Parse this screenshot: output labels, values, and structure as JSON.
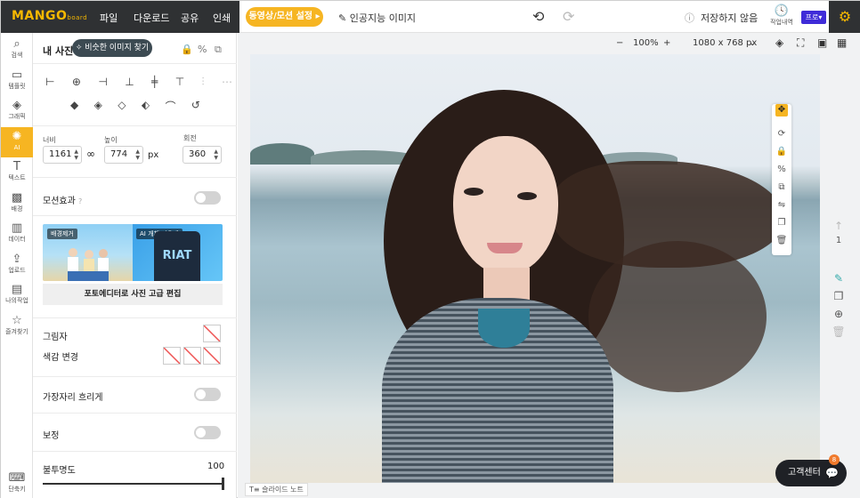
{
  "topbar": {
    "logo": "MANGO",
    "logo_sub": "board",
    "menus": [
      "파일",
      "다운로드",
      "공유",
      "인쇄"
    ],
    "motion_button": "동영상/모션 설정 ▸",
    "ai_image": "인공지능 이미지",
    "save_status": "저장하지 않음",
    "history_label": "작업내역",
    "pro_badge": "프로▾"
  },
  "rail": [
    {
      "icon": "search-icon",
      "label": "검색"
    },
    {
      "icon": "template-icon",
      "label": "템플릿"
    },
    {
      "icon": "graphic-icon",
      "label": "그래픽"
    },
    {
      "icon": "ai-icon",
      "label": "AI",
      "active": true
    },
    {
      "icon": "text-icon",
      "label": "텍스트"
    },
    {
      "icon": "background-icon",
      "label": "배경"
    },
    {
      "icon": "data-icon",
      "label": "데이터"
    },
    {
      "icon": "upload-icon",
      "label": "업로드"
    },
    {
      "icon": "mywork-icon",
      "label": "나의작업"
    },
    {
      "icon": "favorite-icon",
      "label": "즐겨찾기"
    },
    {
      "icon": "shortcut-icon",
      "label": "단축키"
    }
  ],
  "panel": {
    "title": "내 사진",
    "similar_button": "비슷한 이미지 찾기",
    "width_label": "너비",
    "height_label": "높이",
    "rotate_label": "회전",
    "width_value": "1161",
    "height_value": "774",
    "unit": "px",
    "rotate_value": "360",
    "motion_effect": "모션효과",
    "motion_effect_on": false,
    "promo_tag_1": "배경제거",
    "promo_tag_2": "AI 개체 지우개",
    "promo_can_text": "RIAT",
    "photo_edit_button": "포토에디터로 사진 고급 편집",
    "shadow": "그림자",
    "color_change": "색감 변경",
    "edge_blur": "가장자리 흐리게",
    "edge_blur_on": false,
    "correction": "보정",
    "correction_on": false,
    "opacity_label": "불투명도",
    "opacity_value": "100",
    "opacity_level": 1.0
  },
  "canvas": {
    "zoom": "100%",
    "size": "1080 x 768 px",
    "page_number": "1",
    "slide_note": "슬라이드 노트",
    "help": "고객센터",
    "help_badge": "8"
  }
}
